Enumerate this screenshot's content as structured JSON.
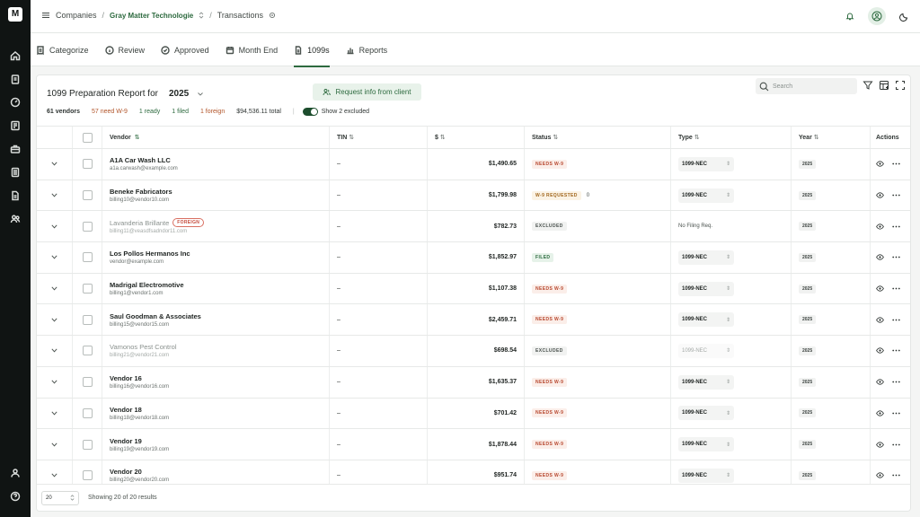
{
  "breadcrumb": {
    "companies": "Companies",
    "org": "Gray Matter Technologie",
    "page": "Transactions"
  },
  "tabs": [
    {
      "label": "Categorize",
      "icon": "receipt-icon"
    },
    {
      "label": "Review",
      "icon": "info-icon"
    },
    {
      "label": "Approved",
      "icon": "check-circle-icon"
    },
    {
      "label": "Month End",
      "icon": "calendar-icon"
    },
    {
      "label": "1099s",
      "icon": "document-icon"
    },
    {
      "label": "Reports",
      "icon": "bar-chart-icon"
    }
  ],
  "report": {
    "title": "1099 Preparation Report for",
    "year": "2025",
    "request_button": "Request info from client",
    "search_placeholder": "Search",
    "show_excluded": "Show 2 excluded"
  },
  "stats": {
    "vendors": "61 vendors",
    "need_w9": "57 need W-9",
    "ready": "1 ready",
    "filed": "1 filed",
    "foreign": "1 foreign",
    "total": "$94,536.11 total"
  },
  "columns": {
    "vendor": "Vendor",
    "tin": "TIN",
    "amount": "$",
    "status": "Status",
    "type": "Type",
    "year": "Year",
    "actions": "Actions"
  },
  "rows": [
    {
      "name": "A1A Car Wash LLC",
      "email": "a1a.carwash@example.com",
      "tin": "–",
      "amount": "$1,490.65",
      "status": "NEEDS W-9",
      "status_kind": "need",
      "type": "1099-NEC",
      "type_kind": "select",
      "year": "2025"
    },
    {
      "name": "Beneke Fabricators",
      "email": "billing10@vendor10.com",
      "tin": "–",
      "amount": "$1,799.98",
      "status": "W-9 REQUESTED",
      "status_kind": "req",
      "status_extra": "0",
      "type": "1099-NEC",
      "type_kind": "select",
      "year": "2025"
    },
    {
      "name": "Lavanderia Brillante",
      "email": "billing11@veasdfsadndor11.com",
      "tin": "–",
      "amount": "$782.73",
      "status": "EXCLUDED",
      "status_kind": "exc",
      "type": "No Filing Req.",
      "type_kind": "text",
      "year": "2025",
      "dim": true,
      "foreign": "FOREIGN"
    },
    {
      "name": "Los Pollos Hermanos Inc",
      "email": "vendor@example.com",
      "tin": "–",
      "amount": "$1,852.97",
      "status": "FILED",
      "status_kind": "filed",
      "type": "1099-NEC",
      "type_kind": "select",
      "year": "2025"
    },
    {
      "name": "Madrigal Electromotive",
      "email": "billing1@vendor1.com",
      "tin": "–",
      "amount": "$1,107.38",
      "status": "NEEDS W-9",
      "status_kind": "need",
      "type": "1099-NEC",
      "type_kind": "select",
      "year": "2025"
    },
    {
      "name": "Saul Goodman & Associates",
      "email": "billing15@vendor15.com",
      "tin": "–",
      "amount": "$2,459.71",
      "status": "NEEDS W-9",
      "status_kind": "need",
      "type": "1099-NEC",
      "type_kind": "select",
      "year": "2025"
    },
    {
      "name": "Vamonos Pest Control",
      "email": "billing21@vendor21.com",
      "tin": "–",
      "amount": "$698.54",
      "status": "EXCLUDED",
      "status_kind": "exc",
      "type": "1099-NEC",
      "type_kind": "disabled",
      "year": "2025",
      "dim": true
    },
    {
      "name": "Vendor 16",
      "email": "billing16@vendor16.com",
      "tin": "–",
      "amount": "$1,635.37",
      "status": "NEEDS W-9",
      "status_kind": "need",
      "type": "1099-NEC",
      "type_kind": "select",
      "year": "2025"
    },
    {
      "name": "Vendor 18",
      "email": "billing18@vendor18.com",
      "tin": "–",
      "amount": "$701.42",
      "status": "NEEDS W-9",
      "status_kind": "need",
      "type": "1099-NEC",
      "type_kind": "select",
      "year": "2025"
    },
    {
      "name": "Vendor 19",
      "email": "billing19@vendor19.com",
      "tin": "–",
      "amount": "$1,878.44",
      "status": "NEEDS W-9",
      "status_kind": "need",
      "type": "1099-NEC",
      "type_kind": "select",
      "year": "2025"
    },
    {
      "name": "Vendor 20",
      "email": "billing20@vendor20.com",
      "tin": "–",
      "amount": "$951.74",
      "status": "NEEDS W-9",
      "status_kind": "need",
      "type": "1099-NEC",
      "type_kind": "select",
      "year": "2025"
    }
  ],
  "footer": {
    "page_size": "20",
    "summary": "Showing 20 of 20 results"
  },
  "colors": {
    "brand": "#2d6a3f",
    "rail": "#101413",
    "warn": "#b8482f"
  }
}
